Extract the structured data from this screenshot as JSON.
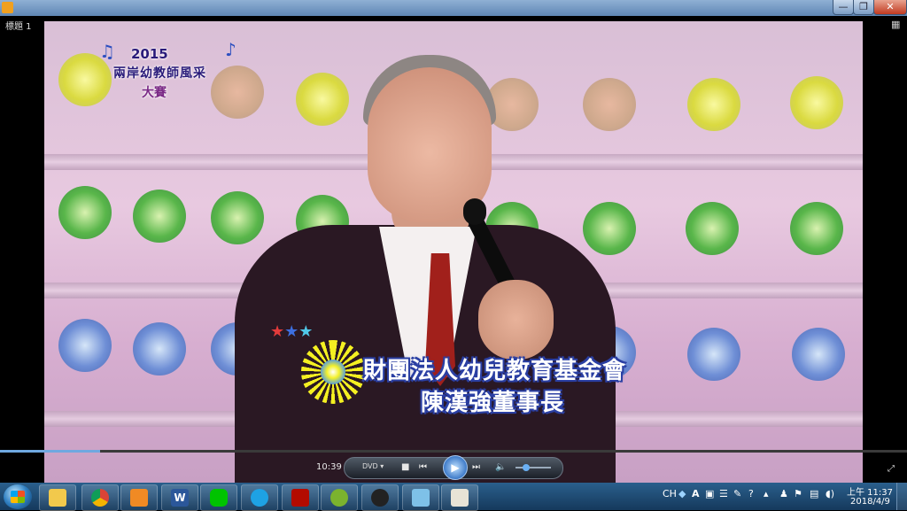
{
  "window": {
    "title": "標題 1",
    "buttons": {
      "minimize": "—",
      "maximize": "❐",
      "close": "✕"
    }
  },
  "video": {
    "logo": {
      "year": "2015",
      "line1": "兩岸幼教師風采",
      "line2": "大賽"
    },
    "caption_line1": "財團法人幼兒教育基金會",
    "caption_line2": "陳漢強董事長"
  },
  "player": {
    "time": "10:39",
    "source": "DVD",
    "stop_icon": "■",
    "prev_icon": "⏮",
    "play_icon": "▶",
    "next_icon": "⏭",
    "volume_icon": "🔈",
    "seek_progress": 0.11,
    "volume_level": 0.3
  },
  "taskbar": {
    "apps": [
      "file-explorer",
      "chrome",
      "media-player",
      "word",
      "line",
      "internet-explorer",
      "acrobat",
      "wechat",
      "qq",
      "picture-viewer",
      "paint"
    ],
    "tray": {
      "lang": "CH",
      "ime": "A"
    },
    "time": "上午 11:37",
    "date": "2018/4/9"
  },
  "colors": {
    "accent": "#2f7fc1",
    "caption_outline": "#2a3fa3",
    "tie": "#a1201b"
  }
}
